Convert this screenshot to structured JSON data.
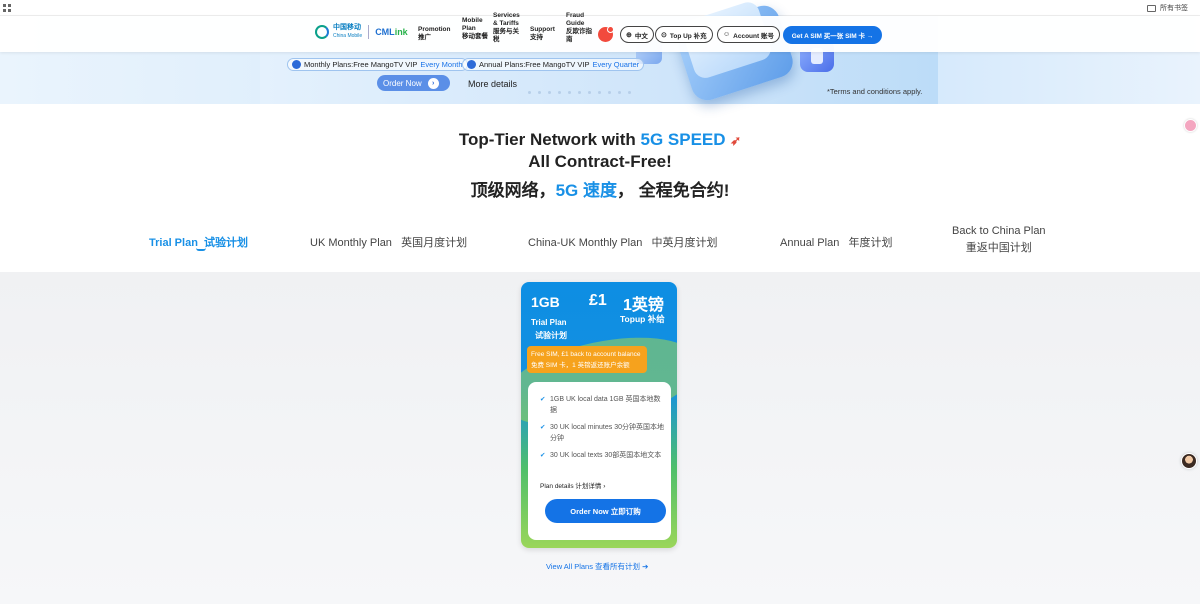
{
  "browser": {
    "all_bookmarks": "所有书签"
  },
  "nav": {
    "logo_cn": "中国移动",
    "logo_en": "China Mobile",
    "cmlink_cm": "CML",
    "cmlink_k": "ink",
    "items": [
      {
        "en": "Promotion",
        "cn": "推广"
      },
      {
        "en": "Mobile Plan",
        "cn": "移动套餐"
      },
      {
        "en": "Services & Tariffs",
        "cn": "服务与关税"
      },
      {
        "en": "Support",
        "cn": "支持"
      },
      {
        "en": "Fraud Guide",
        "cn": "反欺诈指南"
      }
    ],
    "lang": "中文",
    "topup": "Top Up  补充",
    "account": "Account  账号",
    "get_sim": "Get A SIM  买一张 SIM 卡 →"
  },
  "hero": {
    "monthly_prefix": "Monthly Plans:Free MangoTV VIP ",
    "monthly_hl": "Every Month",
    "annual_prefix": "Annual Plans:Free MangoTV VIP ",
    "annual_hl": "Every Quarter",
    "order_now": "Order Now",
    "more_details": "More details",
    "terms": "*Terms and conditions apply."
  },
  "headline": {
    "line1_a": "Top-Tier Network with ",
    "line1_b": "5G SPEED",
    "line2": "All Contract-Free!",
    "line3_a": "顶级网络，",
    "line3_b": "5G 速度",
    "line3_c": "， 全程免合约!"
  },
  "tabs": [
    {
      "en": "Trial Plan",
      "cn": "试验计划",
      "active": true
    },
    {
      "en": "UK Monthly Plan",
      "cn": "英国月度计划",
      "active": false
    },
    {
      "en": "China-UK Monthly Plan",
      "cn": "中英月度计划",
      "active": false
    },
    {
      "en": "Annual Plan",
      "cn": "年度计划",
      "active": false
    },
    {
      "en": "Back to China Plan",
      "cn": "重返中国计划",
      "active": false
    }
  ],
  "card": {
    "data": "1GB",
    "price": "£1",
    "topup_amount": "1英镑",
    "topup_label": "Topup  补给",
    "plan_en": "Trial Plan",
    "plan_cn": "试验计划",
    "badge_en": "Free SIM, £1 back to account balance",
    "badge_cn": "免费 SIM 卡，1 英镑返还账户余额",
    "features": [
      "1GB UK local data  1GB 英国本地数据",
      "30 UK local minutes  30分钟英国本地分钟",
      "30 UK local texts  30部英国本地文本"
    ],
    "plan_details": "Plan details  计划详情 ›",
    "order_now": "Order Now  立即订购"
  },
  "view_all": "View All Plans  查看所有计划 ➔"
}
